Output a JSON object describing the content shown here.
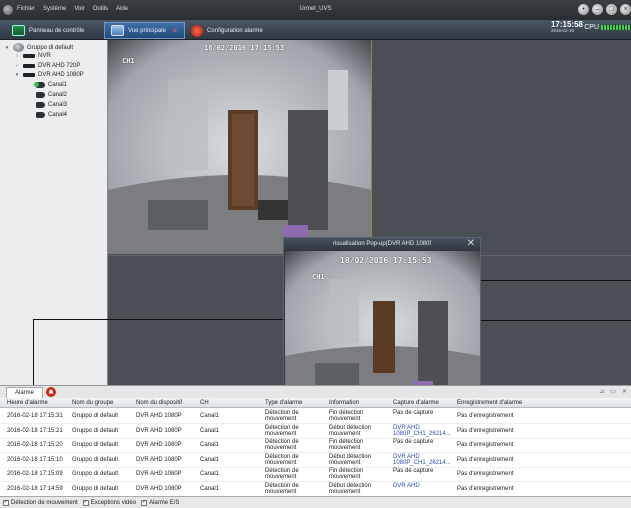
{
  "window": {
    "title": "Urmet_UVS",
    "menu": [
      "Fichier",
      "Système",
      "Voir",
      "Outils",
      "Aide"
    ]
  },
  "tabs": [
    {
      "label": "Panneau de contrôle",
      "icon": "control-panel-icon"
    },
    {
      "label": "Vue principale",
      "icon": "main-view-icon",
      "active": true
    },
    {
      "label": "Configuration alarme",
      "icon": "alarm-config-icon"
    }
  ],
  "status": {
    "time": "17:15:58",
    "date": "2016-02-18",
    "cpu_label": "CPU"
  },
  "tree": {
    "root": "Gruppo di default",
    "devices": [
      "NVR",
      "DVR AHD 720P",
      "DVR AHD 1080P"
    ],
    "channels": [
      "Canal1",
      "Canal2",
      "Canal3",
      "Canal4"
    ]
  },
  "video": {
    "main": {
      "timestamp": "18/02/2016 17:15:53",
      "channel": "CH1"
    },
    "popup": {
      "title": "risualisation Pop-up(DVR AHD 1080f",
      "timestamp": "18/02/2016 17:15:53",
      "channel": "CH1"
    }
  },
  "alarm_panel": {
    "tab_label": "Alarme",
    "columns": [
      "Heure d'alarme",
      "Nom du groupe",
      "Nom du dispositif",
      "CH",
      "Type d'alarme",
      "Information",
      "Capture d'alarme",
      "Enregistrement d'alarme"
    ],
    "rows": [
      [
        "2016-02-18 17:15:31",
        "Gruppo di default",
        "DVR AHD 1080P",
        "Canal1",
        "Détection de mouvement",
        "Fin détection mouvement",
        "Pas de capture",
        "Pas d'enregistrement"
      ],
      [
        "2016-02-18 17:15:21",
        "Gruppo di default",
        "DVR AHD 1080P",
        "Canal1",
        "Détection de mouvement",
        "Début détection mouvement",
        "DVR AHD 1080P_CH1_26214...",
        "Pas d'enregistrement"
      ],
      [
        "2016-02-18 17:15:20",
        "Gruppo di default",
        "DVR AHD 1080P",
        "Canal1",
        "Détection de mouvement",
        "Fin détection mouvement",
        "Pas de capture",
        "Pas d'enregistrement"
      ],
      [
        "2016-02-18 17:15:10",
        "Gruppo di default",
        "DVR AHD 1080P",
        "Canal1",
        "Détection de mouvement",
        "Début détection mouvement",
        "DVR AHD 1080P_CH1_26214...",
        "Pas d'enregistrement"
      ],
      [
        "2016-02-18 17:15:09",
        "Gruppo di default",
        "DVR AHD 1080P",
        "Canal1",
        "Détection de mouvement",
        "Fin détection mouvement",
        "Pas de capture",
        "Pas d'enregistrement"
      ],
      [
        "2016-02-18 17:14:59",
        "Gruppo di default",
        "DVR AHD 1080P",
        "Canal1",
        "Détection de mouvement",
        "Début détection mouvement",
        "DVR AHD",
        "Pas d'enregistrement"
      ]
    ]
  },
  "filters": [
    "Détection de mouvement",
    "Exceptions vidéo",
    "Alarme E/S"
  ]
}
